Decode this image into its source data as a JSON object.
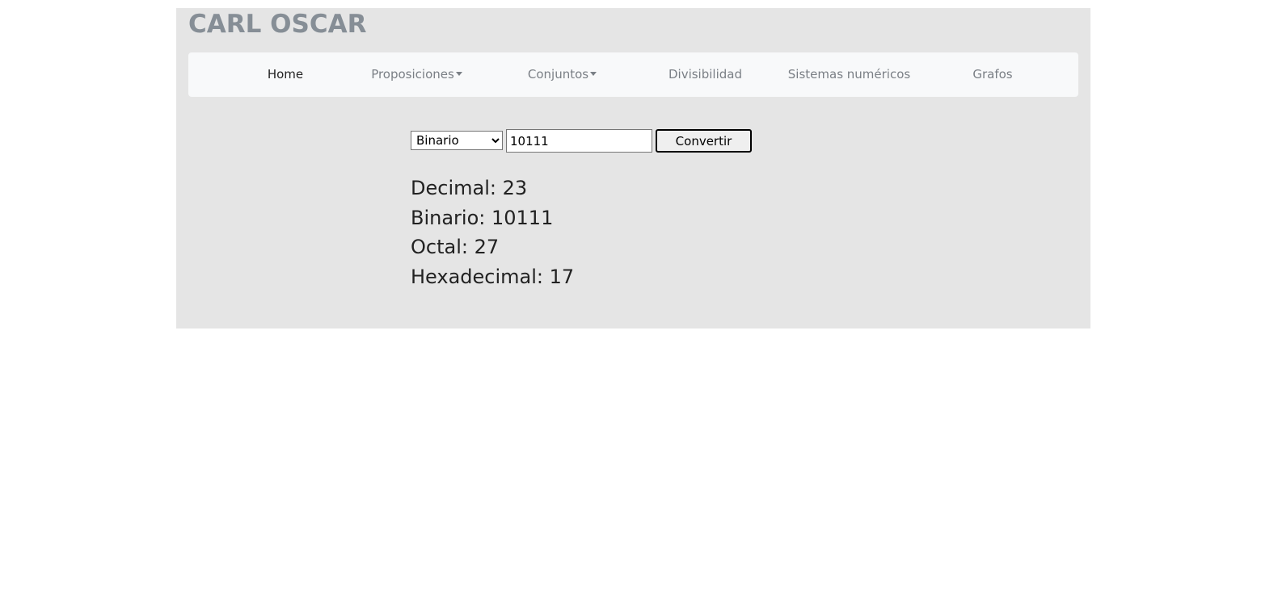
{
  "brand": "CARL OSCAR",
  "nav": {
    "items": [
      {
        "label": "Home",
        "active": true
      },
      {
        "label": "Proposiciones",
        "dropdown": true
      },
      {
        "label": "Conjuntos",
        "dropdown": true
      },
      {
        "label": "Divisibilidad"
      },
      {
        "label": "Sistemas numéricos"
      },
      {
        "label": "Grafos"
      }
    ]
  },
  "converter": {
    "selected_base": "Binario",
    "input_value": "10111",
    "button_label": "Convertir"
  },
  "results": {
    "decimal": "Decimal: 23",
    "binario": "Binario: 10111",
    "octal": "Octal: 27",
    "hexadecimal": "Hexadecimal: 17"
  },
  "colors": {
    "page_bg": "#ffffff",
    "container_bg": "#e5e5e5",
    "navbar_bg": "#f8f9fa",
    "brand": "#868e96",
    "nav_inactive": "#7a7f85",
    "nav_active": "#222222"
  }
}
